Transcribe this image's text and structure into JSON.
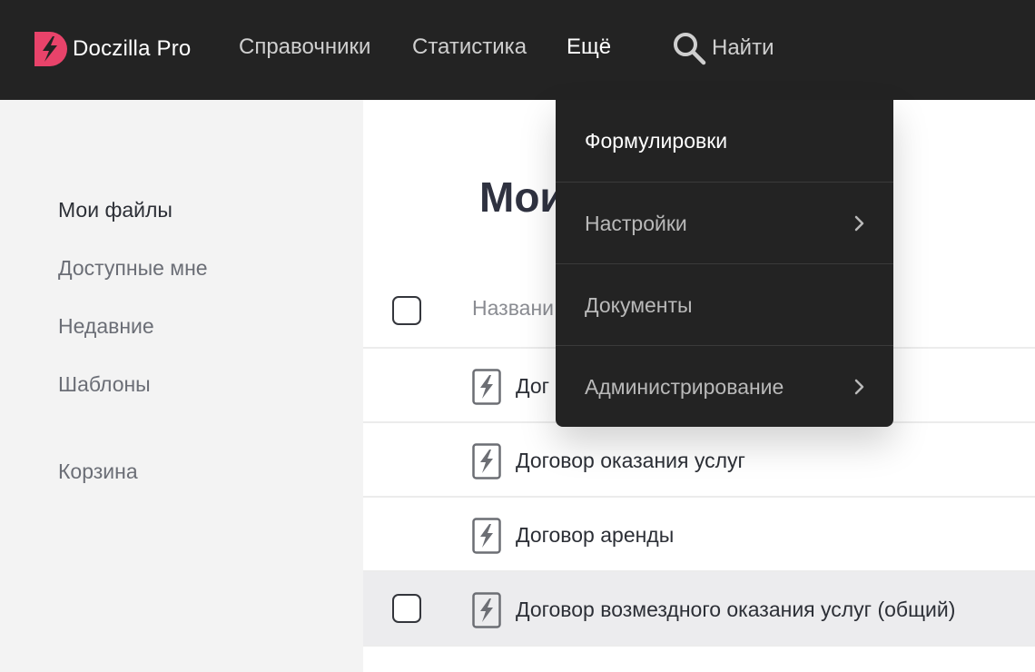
{
  "app": {
    "name": "Doczilla Pro",
    "brand_color": "#e8436a"
  },
  "nav": {
    "items": [
      {
        "label": "Справочники"
      },
      {
        "label": "Статистика"
      },
      {
        "label": "Ещё"
      }
    ],
    "search_label": "Найти",
    "search_icon": "search-icon"
  },
  "sidebar": {
    "items": [
      {
        "label": "Мои файлы"
      },
      {
        "label": "Доступные мне"
      },
      {
        "label": "Недавние"
      },
      {
        "label": "Шаблоны"
      },
      {
        "label": "Корзина"
      }
    ]
  },
  "main": {
    "title": "Мои",
    "column_header": "Названи",
    "rows": [
      {
        "name": "Дог",
        "icon": "document-template-icon"
      },
      {
        "name": "Договор оказания услуг",
        "icon": "document-template-icon"
      },
      {
        "name": "Договор аренды",
        "icon": "document-template-icon"
      },
      {
        "name": "Договор возмездного оказания услуг (общий)",
        "icon": "document-template-icon"
      }
    ]
  },
  "dropdown": {
    "items": [
      {
        "label": "Формулировки",
        "has_submenu": false
      },
      {
        "label": "Настройки",
        "has_submenu": true
      },
      {
        "label": "Документы",
        "has_submenu": false
      },
      {
        "label": "Администрирование",
        "has_submenu": true
      }
    ]
  }
}
